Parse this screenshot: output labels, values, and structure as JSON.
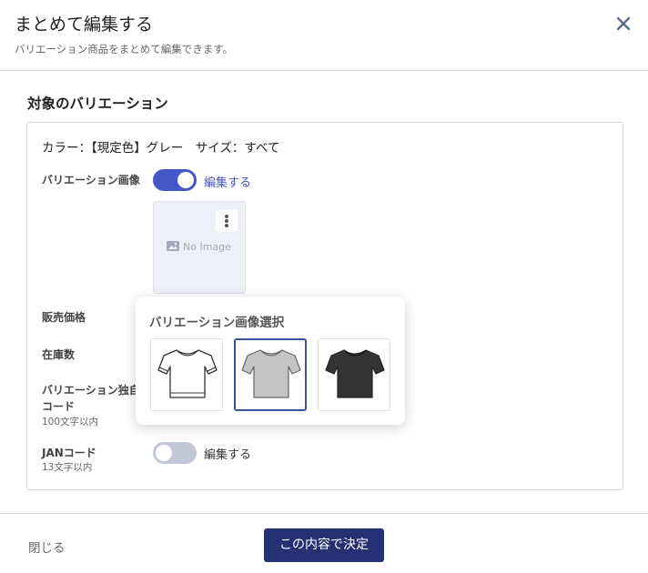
{
  "modal": {
    "title": "まとめて編集する",
    "subtitle": "バリエーション商品をまとめて編集できます。",
    "close_icon": "close-icon"
  },
  "section": {
    "title": "対象のバリエーション",
    "target_text": "カラー：【現定色】グレー　サイズ：すべて"
  },
  "fields": {
    "image": {
      "label": "バリエーション画像",
      "toggle_on": true,
      "toggle_label": "編集する",
      "no_image_text": "No Image"
    },
    "price": {
      "label": "販売価格"
    },
    "stock": {
      "label": "在庫数"
    },
    "code": {
      "label_line1": "バリエーション独自",
      "label_line2": "コード",
      "hint": "100文字以内"
    },
    "jan": {
      "label": "JANコード",
      "hint": "13文字以内",
      "toggle_on": false,
      "toggle_label": "編集する"
    }
  },
  "popover": {
    "title": "バリエーション画像選択",
    "options": [
      {
        "name": "white-tshirt",
        "color": "#ffffff",
        "selected": false
      },
      {
        "name": "gray-tshirt",
        "color": "#c4c4c4",
        "selected": true
      },
      {
        "name": "black-tshirt",
        "color": "#333333",
        "selected": false
      }
    ]
  },
  "footer": {
    "close_label": "閉じる",
    "submit_label": "この内容で決定"
  },
  "colors": {
    "accent": "#4357c7",
    "primary_button": "#253173",
    "toggle_off": "#c1c7d9"
  }
}
